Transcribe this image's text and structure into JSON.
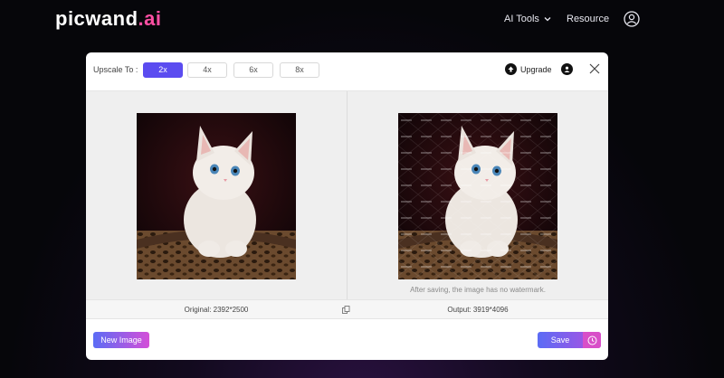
{
  "header": {
    "logo_main": "picwand",
    "logo_dot": ".",
    "logo_ai": "ai",
    "nav": [
      {
        "label": "AI Tools",
        "icon": "chevron-down-icon"
      },
      {
        "label": "Resource"
      }
    ],
    "user_icon": "user-circle-icon"
  },
  "modal": {
    "upscale_label": "Upscale To :",
    "scales": [
      {
        "label": "2x",
        "active": true
      },
      {
        "label": "4x",
        "active": false
      },
      {
        "label": "6x",
        "active": false
      },
      {
        "label": "8x",
        "active": false
      }
    ],
    "upgrade_label": "Upgrade",
    "upgrade_icon": "upgrade-arrow-icon",
    "account_icon": "account-icon",
    "close_icon": "close-icon",
    "watermark_note": "After saving, the image has no watermark.",
    "original_label": "Original: 2392*2500",
    "output_label": "Output: 3919*4096",
    "new_image_label": "New Image",
    "save_label": "Save",
    "accent": "#5b4cf0"
  }
}
